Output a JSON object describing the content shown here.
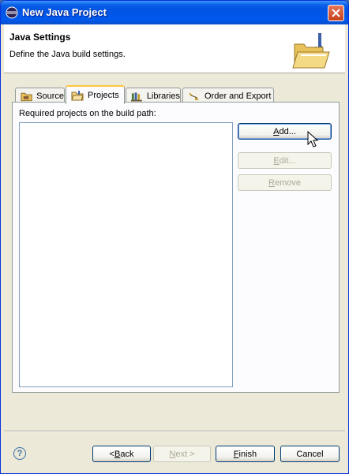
{
  "window": {
    "title": "New Java Project"
  },
  "header": {
    "title": "Java Settings",
    "description": "Define the Java build settings."
  },
  "tabs": [
    {
      "label": "Source",
      "icon": "source-folder-icon"
    },
    {
      "label": "Projects",
      "icon": "projects-folder-icon",
      "active": true
    },
    {
      "label": "Libraries",
      "icon": "libraries-icon"
    },
    {
      "label": "Order and Export",
      "icon": "order-export-icon"
    }
  ],
  "projects_panel": {
    "label": "Required projects on the build path:",
    "buttons": {
      "add": {
        "pre": "",
        "mnemonic": "A",
        "post": "dd..."
      },
      "edit": {
        "pre": "",
        "mnemonic": "E",
        "post": "dit..."
      },
      "remove": {
        "pre": "",
        "mnemonic": "R",
        "post": "emove"
      }
    }
  },
  "footer": {
    "back": {
      "pre": "< ",
      "mnemonic": "B",
      "post": "ack"
    },
    "next": {
      "pre": "",
      "mnemonic": "N",
      "post": "ext >"
    },
    "finish": {
      "pre": "",
      "mnemonic": "F",
      "post": "inish"
    },
    "cancel": {
      "label": "Cancel"
    }
  },
  "colors": {
    "title_bar": "#0058ee",
    "accent_tab": "#ffc83c"
  }
}
